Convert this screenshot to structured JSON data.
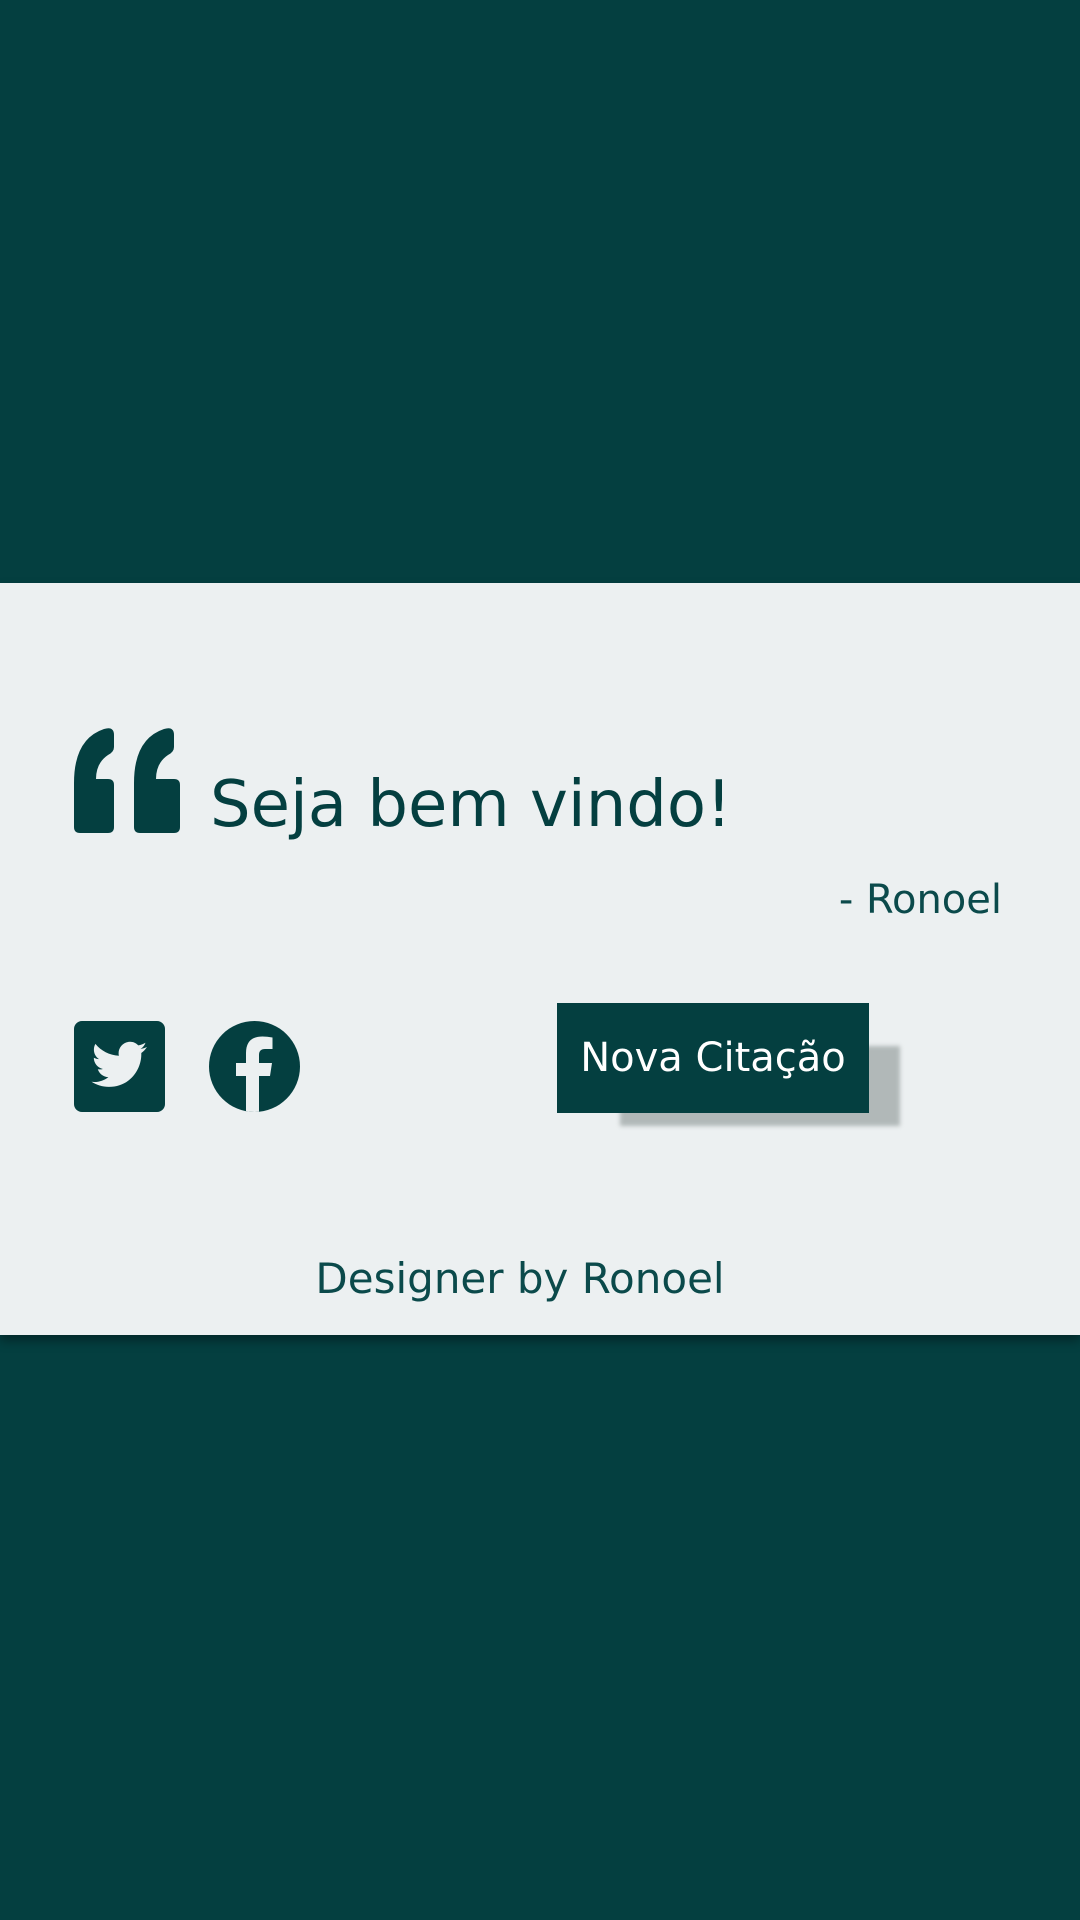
{
  "colors": {
    "background": "#043f40",
    "card": "#ecf0f1",
    "accent": "#043f40",
    "button_text": "#ffffff",
    "button_shadow": "#b1b8b8"
  },
  "quote": {
    "icon": "quote-left-icon",
    "text": "Seja bem vindo!",
    "author": "- Ronoel"
  },
  "social": {
    "twitter_icon": "twitter-icon",
    "facebook_icon": "facebook-icon"
  },
  "actions": {
    "new_quote_label": "Nova Citação"
  },
  "footer": {
    "credit": "Designer by Ronoel"
  }
}
